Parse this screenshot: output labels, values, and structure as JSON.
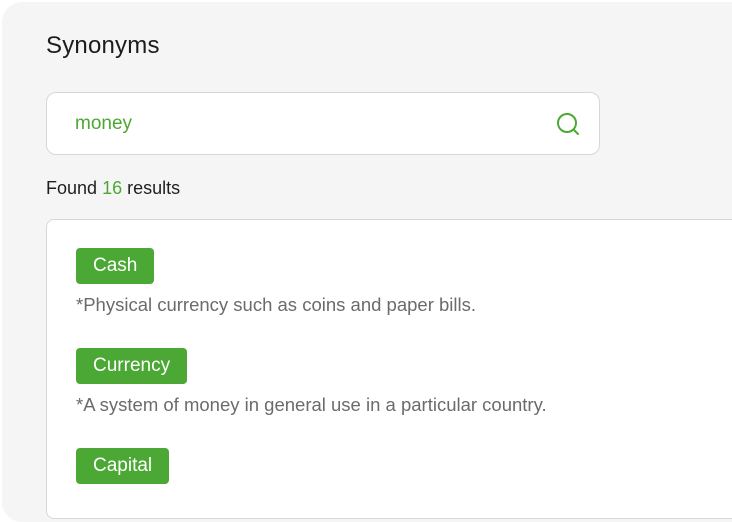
{
  "panel": {
    "title": "Synonyms"
  },
  "search": {
    "value": "money",
    "placeholder": ""
  },
  "summary": {
    "prefix": "Found",
    "count": "16",
    "suffix": "results"
  },
  "results": [
    {
      "word": "Cash",
      "definition": "*Physical currency such as coins and paper bills."
    },
    {
      "word": "Currency",
      "definition": "*A system of money in general use in a particular country."
    },
    {
      "word": "Capital",
      "definition": ""
    }
  ],
  "colors": {
    "accent": "#4ca834",
    "panel_background": "#f5f5f5",
    "definition_text": "#6b6b6b"
  },
  "icons": {
    "search": "search-icon"
  }
}
